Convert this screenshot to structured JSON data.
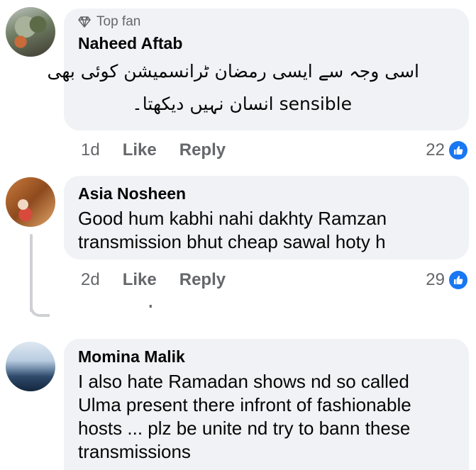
{
  "comments": [
    {
      "badge": "Top fan",
      "author": "Naheed Aftab",
      "text_line1": "اسی وجہ سے ایسی رمضان ٹرانسمیشن کوئی بھی",
      "text_line2": "sensible انسان نہیں دیکھتا۔",
      "time": "1d",
      "like_label": "Like",
      "reply_label": "Reply",
      "reaction_count": "22"
    },
    {
      "author": "Asia Nosheen",
      "text": "Good hum kabhi nahi dakhty Ramzan transmission bhut cheap sawal hoty h",
      "time": "2d",
      "like_label": "Like",
      "reply_label": "Reply",
      "reaction_count": "29"
    },
    {
      "author": "Momina Malik",
      "text": "I also hate Ramadan shows nd so called Ulma  present there infront of fashionable hosts ... plz be unite nd try to bann these transmissions"
    }
  ],
  "thread": {
    "cut_label": "reply"
  },
  "colors": {
    "bubble": "#f0f2f5",
    "meta": "#65676b",
    "like_blue": "#1877f2",
    "thread": "#ced0d4"
  },
  "icons": {
    "badge": "diamond-icon",
    "reaction": "like-thumb-icon"
  }
}
